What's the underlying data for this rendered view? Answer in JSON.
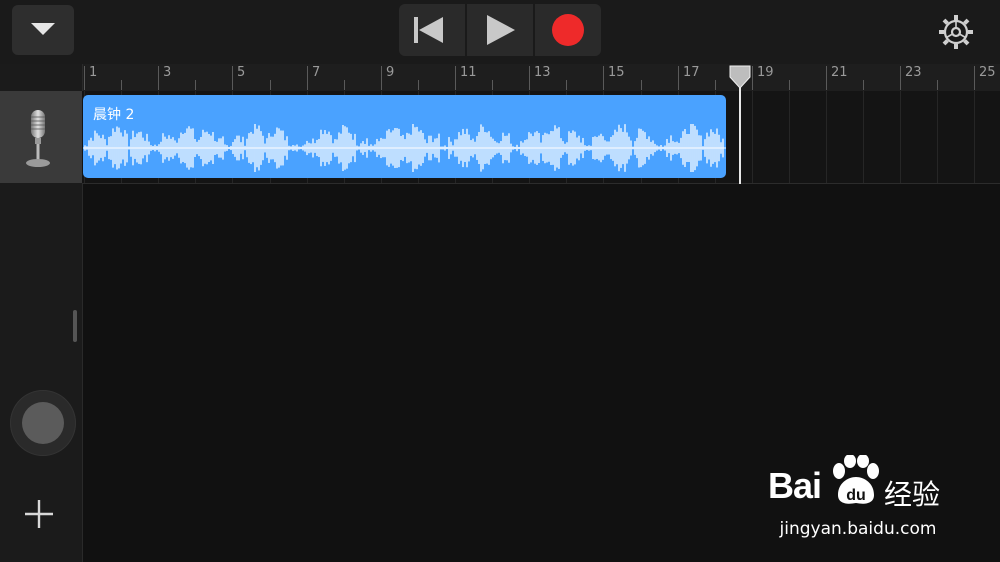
{
  "toolbar": {
    "menu_icon": "chevron-down-icon",
    "transport": {
      "rewind_icon": "skip-to-start-icon",
      "play_icon": "play-icon",
      "record_icon": "record-icon"
    },
    "settings_icon": "gear-icon"
  },
  "ruler": {
    "bar_labels": [
      "1",
      "3",
      "5",
      "7",
      "9",
      "11",
      "13",
      "15",
      "17",
      "19",
      "21",
      "23",
      "25"
    ]
  },
  "track": {
    "instrument_icon": "microphone-icon",
    "region_name": "晨钟 2"
  },
  "controls": {
    "add_track_icon": "plus-icon"
  },
  "watermark": {
    "logo": "Bai",
    "brand_cn": "经验",
    "url": "jingyan.baidu.com"
  },
  "colors": {
    "region": "#4aa2ff",
    "record": "#ee2a2a",
    "background": "#111111"
  }
}
